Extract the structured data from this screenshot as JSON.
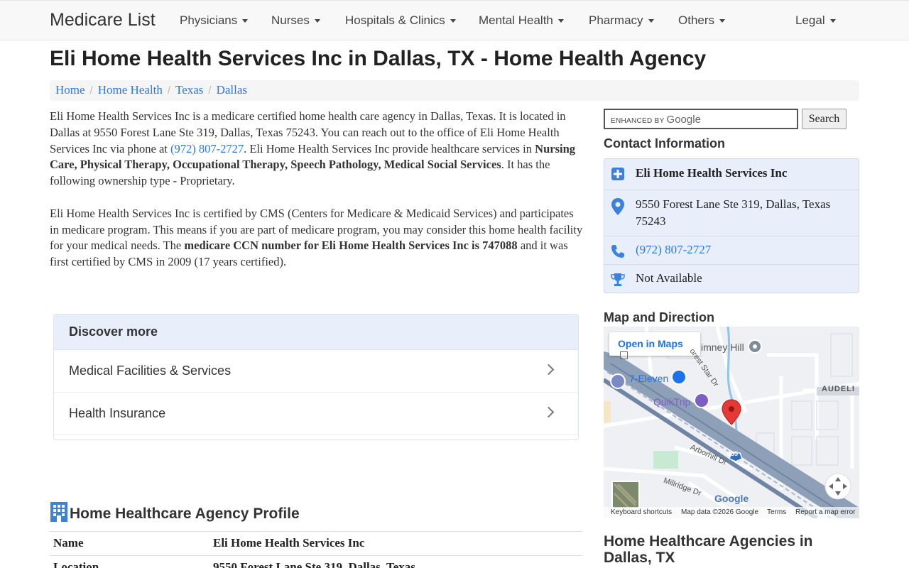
{
  "navbar": {
    "brand": "Medicare List",
    "items": [
      {
        "label": "Physicians"
      },
      {
        "label": "Nurses"
      },
      {
        "label": "Hospitals & Clinics"
      },
      {
        "label": "Mental Health"
      },
      {
        "label": "Pharmacy"
      },
      {
        "label": "Others"
      },
      {
        "label": "Legal"
      }
    ]
  },
  "page": {
    "title": "Eli Home Health Services Inc in Dallas, TX - Home Health Agency"
  },
  "breadcrumb": [
    "Home",
    "Home Health",
    "Texas",
    "Dallas"
  ],
  "description": {
    "p1_a": "Eli Home Health Services Inc is a medicare certified home health care agency in Dallas, Texas. It is located in Dallas at 9550 Forest Lane Ste 319, Dallas, Texas 75243. You can reach out to the office of Eli Home Health Services Inc via phone at ",
    "phone_link": "(972) 807-2727",
    "p1_b": ". Eli Home Health Services Inc provide healthcare services in ",
    "services": "Nursing Care, Physical Therapy, Occupational Therapy, Speech Pathology, Medical Social Services",
    "p1_c": ". It has the following ownership type - Proprietary.",
    "p2_a": "Eli Home Health Services Inc is certified by CMS (Centers for Medicare & Medicaid Services) and participates in medicare program. This means if you are part of medicare program, you may consider this home health facility for your medical needs. The ",
    "ccn_bold": "medicare CCN number for Eli Home Health Services Inc is 747088",
    "p2_b": " and it was first certified by CMS in 2009 (17 years certified)."
  },
  "discover": {
    "heading": "Discover more",
    "items": [
      {
        "label": "Medical Facilities & Services"
      },
      {
        "label": "Health Insurance"
      }
    ]
  },
  "profile": {
    "heading": "Home Healthcare Agency Profile",
    "rows": [
      {
        "label": "Name",
        "value": "Eli Home Health Services Inc"
      },
      {
        "label": "Location",
        "value": "9550 Forest Lane Ste 319, Dallas, Texas"
      }
    ]
  },
  "search": {
    "enhanced_by": "ENHANCED BY",
    "google": "Google",
    "button": "Search"
  },
  "contact": {
    "heading": "Contact Information",
    "name": "Eli Home Health Services Inc",
    "address": "9550 Forest Lane Ste 319, Dallas, Texas 75243",
    "phone": "(972) 807-2727",
    "award": "Not Available"
  },
  "map": {
    "heading": "Map and Direction",
    "open_in_maps": "Open in Maps",
    "labels": {
      "seven_eleven": "7-Eleven",
      "quiktrip": "QuikTrip",
      "chimney_hill": "imney Hill",
      "audelia": "AUDELI",
      "arborhill": "Arborhill Dr",
      "millridge": "Millridge Dr",
      "forest_star": "orest Star Dr",
      "highway": "635",
      "google": "Google"
    },
    "footer": {
      "shortcuts": "Keyboard shortcuts",
      "map_data": "Map data ©2026 Google",
      "terms": "Terms",
      "report": "Report a map error"
    }
  },
  "agencies": {
    "heading": "Home Healthcare Agencies in Dallas, TX"
  },
  "colors": {
    "link": "#2a7ae2",
    "contact_bg": "#e8effa",
    "icon_blue": "#3b82e0"
  }
}
